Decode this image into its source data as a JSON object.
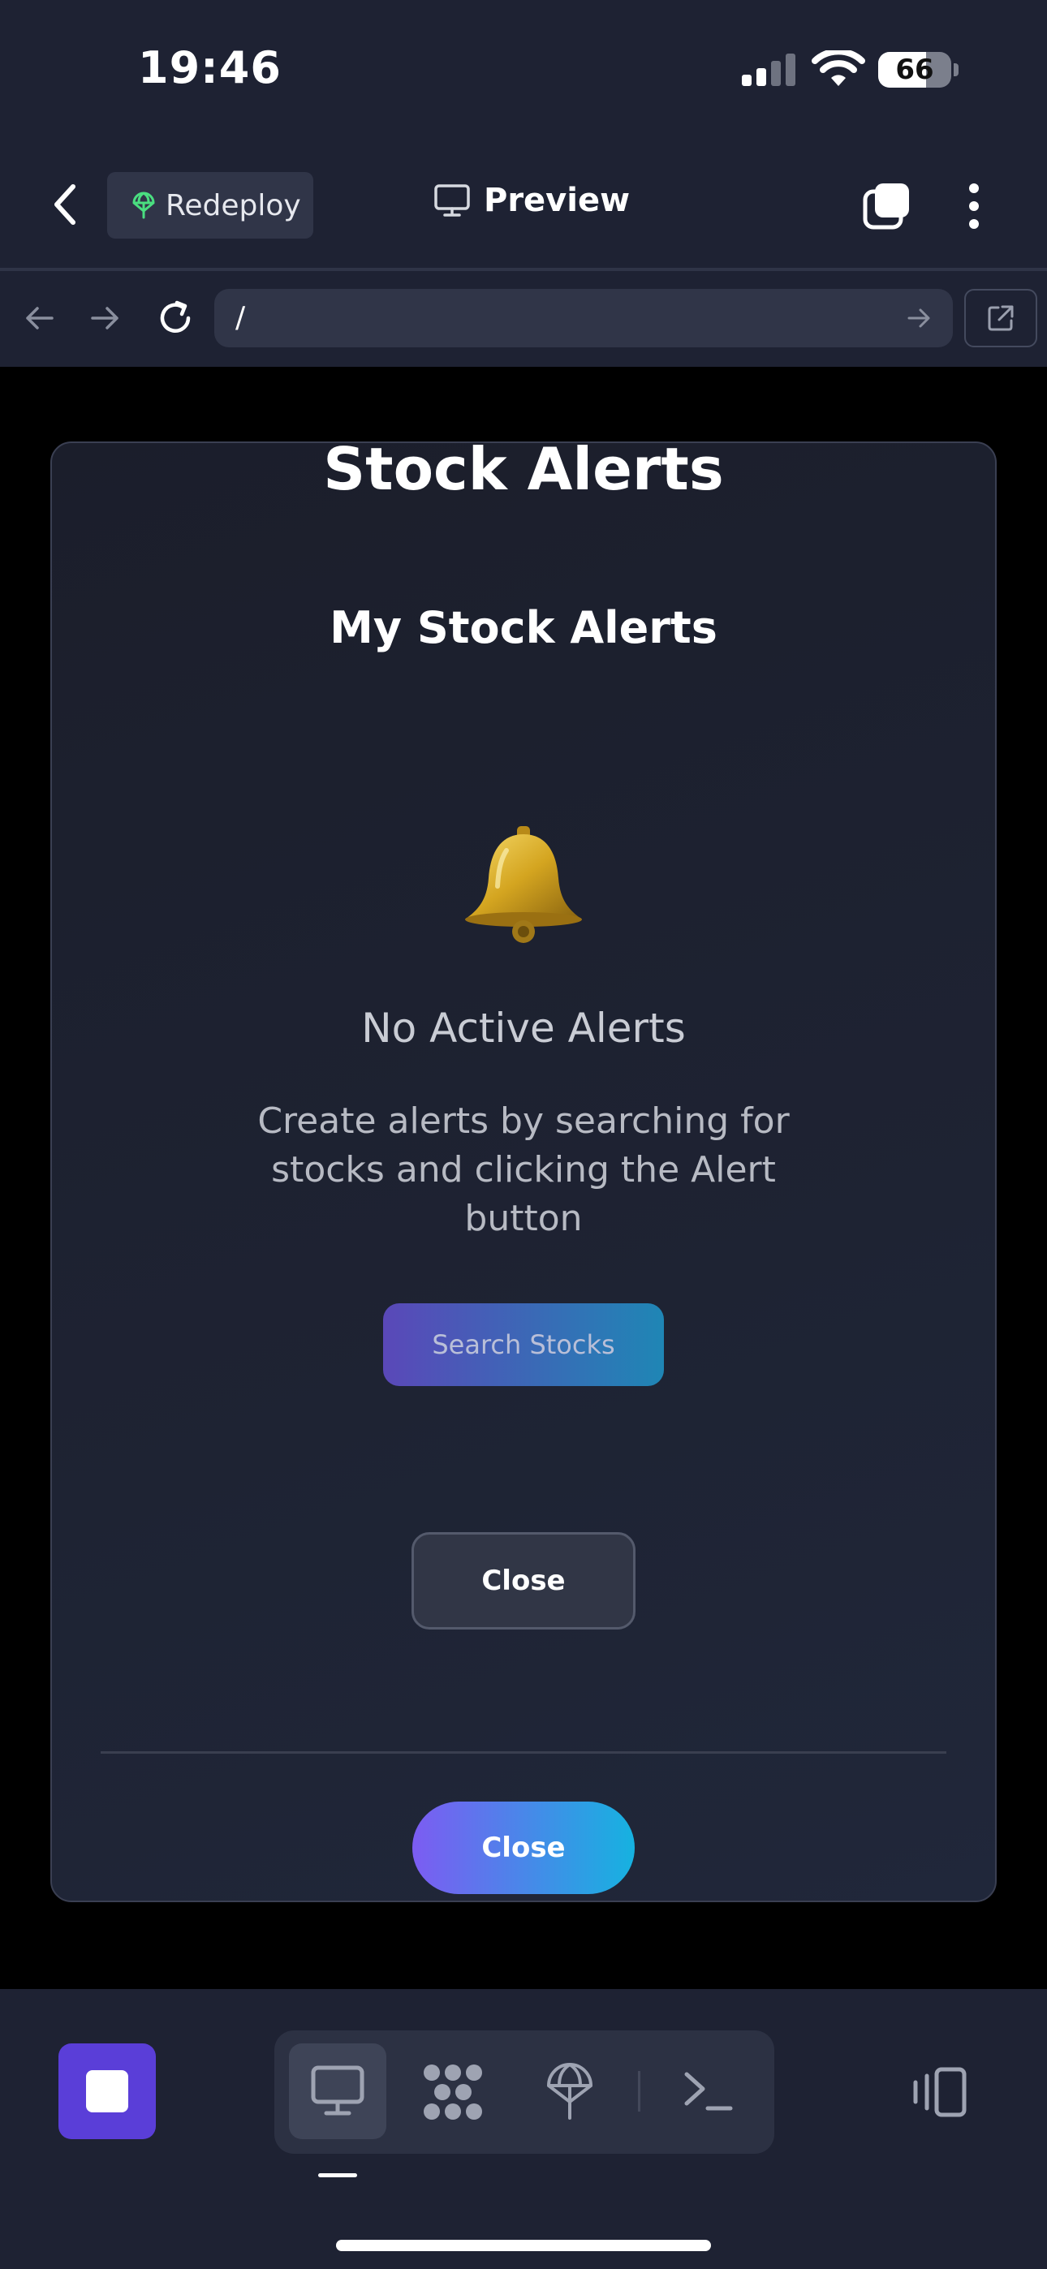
{
  "status_bar": {
    "time": "19:46",
    "battery_level": "66",
    "icons": [
      "signal-icon",
      "wifi-icon",
      "battery-icon"
    ]
  },
  "header": {
    "redeploy_label": "Redeploy",
    "preview_label": "Preview",
    "icons": [
      "back-chevron-icon",
      "globe-icon",
      "monitor-icon",
      "tabs-icon",
      "more-vertical-icon"
    ]
  },
  "browser": {
    "url": "/",
    "icons": [
      "arrow-left-icon",
      "arrow-right-icon",
      "reload-icon",
      "go-arrow-icon",
      "open-external-icon"
    ]
  },
  "modal": {
    "title": "Stock Alerts",
    "section_title": "My Stock Alerts",
    "empty_icon": "bell-icon",
    "empty_title": "No Active Alerts",
    "empty_description": "Create alerts by searching for stocks and clicking the Alert button",
    "search_button": "Search Stocks",
    "close_button_primary": "Close",
    "close_button_footer": "Close"
  },
  "bottom_bar": {
    "icons": [
      "stop-icon",
      "monitor-icon",
      "grid-icon",
      "deploy-icon",
      "terminal-icon",
      "devices-icon"
    ],
    "active_tab": "preview"
  },
  "colors": {
    "app_bg": "#1e2233",
    "accent_purple": "#5a3ed8",
    "gradient_start": "#7c5cf2",
    "gradient_end": "#16b2e0",
    "redeploy_icon_green": "#4ade80"
  }
}
